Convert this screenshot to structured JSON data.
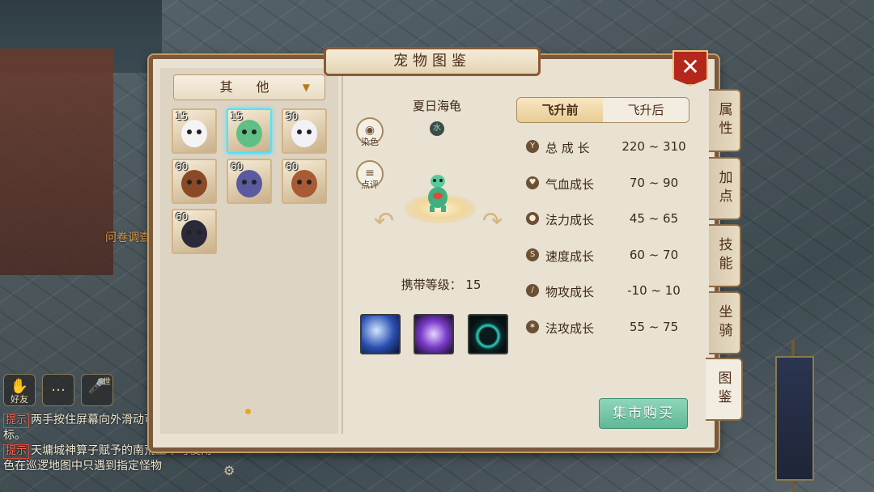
{
  "window": {
    "title": "宠物图鉴",
    "close_label": "✕"
  },
  "filter": {
    "selected": "其 他",
    "arrow": "▼"
  },
  "pets": [
    {
      "level": "15",
      "color": "#f4f4f4",
      "selected": false
    },
    {
      "level": "15",
      "color": "#5fbf84",
      "selected": true
    },
    {
      "level": "50",
      "color": "#f2f2f6",
      "selected": false
    },
    {
      "level": "60",
      "color": "#8a4a28",
      "selected": false
    },
    {
      "level": "60",
      "color": "#5a5aa0",
      "selected": false
    },
    {
      "level": "60",
      "color": "#a85a34",
      "selected": false
    },
    {
      "level": "60",
      "color": "#2a2a3a",
      "selected": false
    }
  ],
  "detail": {
    "pet_name": "夏日海龟",
    "element": "水",
    "dye_label": "染色",
    "comment_label": "点评",
    "carry_level": "携带等级： 15"
  },
  "tabs": {
    "before": "飞升前",
    "after": "飞升后",
    "active": "before"
  },
  "stats": [
    {
      "icon": "Y",
      "name": "总 成 长",
      "value": "220 ~ 310"
    },
    {
      "icon": "♥",
      "name": "气血成长",
      "value": "70 ~ 90"
    },
    {
      "icon": "●",
      "name": "法力成长",
      "value": "45 ~ 65"
    },
    {
      "icon": "S",
      "name": "速度成长",
      "value": "60 ~ 70"
    },
    {
      "icon": "/",
      "name": "物攻成长",
      "value": "-10 ~ 10"
    },
    {
      "icon": "✶",
      "name": "法攻成长",
      "value": "55 ~ 75"
    }
  ],
  "buy_button": "集市购买",
  "side_tabs": [
    "属性",
    "加点",
    "技能",
    "坐骑",
    "图鉴"
  ],
  "side_tab_active": "图鉴",
  "chat": {
    "friends_label": "好友",
    "voice_label": "世",
    "lines": [
      {
        "tag": "提示",
        "text": "两手按住屏幕向外滑动可隐藏界面图标。"
      },
      {
        "tag": "提示",
        "text": "天墉城神算子赋予的南荒巫术可使角色在巡逻地图中只遇到指定怪物"
      }
    ]
  },
  "bg_text": "问卷调查"
}
